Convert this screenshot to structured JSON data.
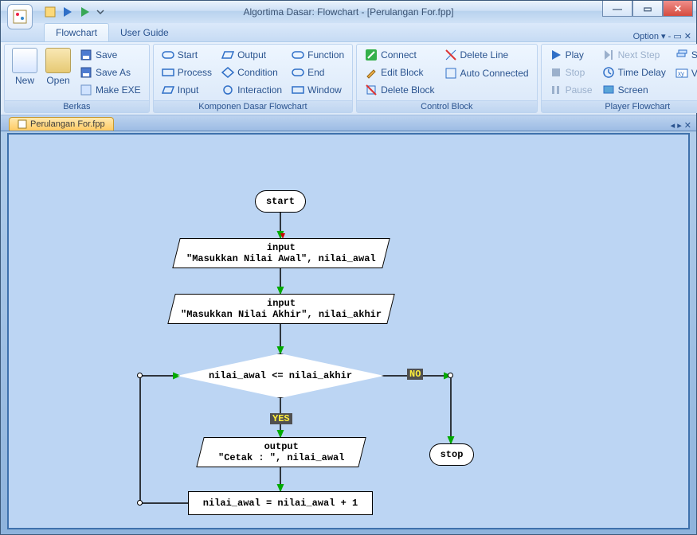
{
  "window": {
    "title": "Algortima Dasar: Flowchart - [Perulangan For.fpp]",
    "min": "—",
    "max": "▭",
    "close": "✕"
  },
  "menu": {
    "tabs": [
      "Flowchart",
      "User Guide"
    ],
    "active": 0,
    "right": "Option ▾  -  ▭  ✕"
  },
  "ribbon": {
    "g0": {
      "cap": "Berkas",
      "new": "New",
      "open": "Open",
      "save": "Save",
      "saveAs": "Save As",
      "makeExe": "Make EXE"
    },
    "g1": {
      "cap": "Komponen Dasar Flowchart",
      "start": "Start",
      "process": "Process",
      "input": "Input",
      "output": "Output",
      "condition": "Condition",
      "interaction": "Interaction",
      "function": "Function",
      "end": "End",
      "window": "Window"
    },
    "g2": {
      "cap": "Control Block",
      "connect": "Connect",
      "editBlock": "Edit Block",
      "deleteBlock": "Delete Block",
      "deleteLine": "Delete Line",
      "autoConn": "Auto Connected"
    },
    "g3": {
      "cap": "Player Flowchart",
      "play": "Play",
      "stop": "Stop",
      "pause": "Pause",
      "nextStep": "Next Step",
      "timeDelay": "Time Delay",
      "screen": "Screen",
      "stack": "Stack",
      "variable": "Variable"
    }
  },
  "docTab": "Perulangan For.fpp",
  "flow": {
    "start": "start",
    "in1a": "input",
    "in1b": "\"Masukkan Nilai Awal\", nilai_awal",
    "in2a": "input",
    "in2b": "\"Masukkan Nilai Akhir\", nilai_akhir",
    "cond": "nilai_awal <= nilai_akhir",
    "yes": "YES",
    "no": "NO",
    "out1a": "output",
    "out1b": "\"Cetak : \", nilai_awal",
    "proc": "nilai_awal = nilai_awal + 1",
    "stop": "stop"
  }
}
